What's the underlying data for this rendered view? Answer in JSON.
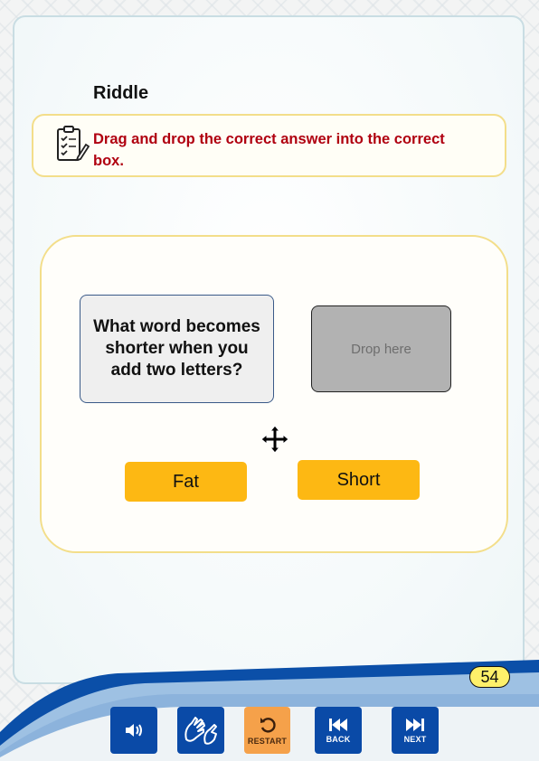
{
  "page": {
    "title": "Riddle",
    "instruction": "Drag and drop the correct answer into the correct box."
  },
  "activity": {
    "question": "What word becomes shorter when you add two letters?",
    "drop_placeholder": "Drop here",
    "answers": [
      "Fat",
      "Short"
    ]
  },
  "footer": {
    "page_number": "54",
    "buttons": {
      "audio_icon": "speaker-icon",
      "sign_icon": "sign-language-icon",
      "restart_label": "RESTART",
      "back_label": "BACK",
      "next_label": "NEXT"
    }
  },
  "colors": {
    "accent_yellow": "#fdb813",
    "instruction_red": "#b00010",
    "nav_blue": "#0a4aa7",
    "restart_orange": "#f5a14a",
    "page_badge": "#fef06a"
  }
}
